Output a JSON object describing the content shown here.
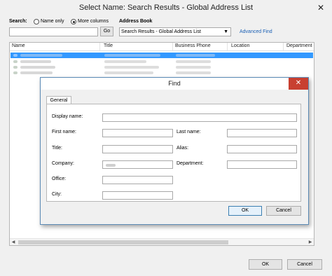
{
  "window": {
    "title": "Select Name: Search Results - Global Address List",
    "close_glyph": "✕"
  },
  "search": {
    "label": "Search:",
    "option_name_only": "Name only",
    "option_more_columns": "More columns",
    "selected_option": "More columns",
    "value": "",
    "go_label": "Go"
  },
  "address_book": {
    "label": "Address Book",
    "selected": "Search Results - Global Address List",
    "advanced_find": "Advanced Find"
  },
  "list": {
    "columns": [
      "Name",
      "Title",
      "Business Phone",
      "Location",
      "Department"
    ],
    "rows_visible": 4,
    "selected_row": 1
  },
  "footer": {
    "ok_label": "OK",
    "cancel_label": "Cancel"
  },
  "find": {
    "title": "Find",
    "close_glyph": "✕",
    "tab_label": "General",
    "fields": {
      "display_name": "Display name:",
      "first_name": "First name:",
      "last_name": "Last name:",
      "title": "Title:",
      "alias": "Alias:",
      "company": "Company:",
      "department": "Department:",
      "office": "Office:",
      "city": "City:"
    },
    "ok_label": "OK",
    "cancel_label": "Cancel"
  },
  "colors": {
    "selection": "#3399ff",
    "close_red": "#c84031",
    "link": "#1a5fb4"
  },
  "icons": {
    "contact": "person-icon",
    "dropdown": "chevron-down-icon"
  }
}
